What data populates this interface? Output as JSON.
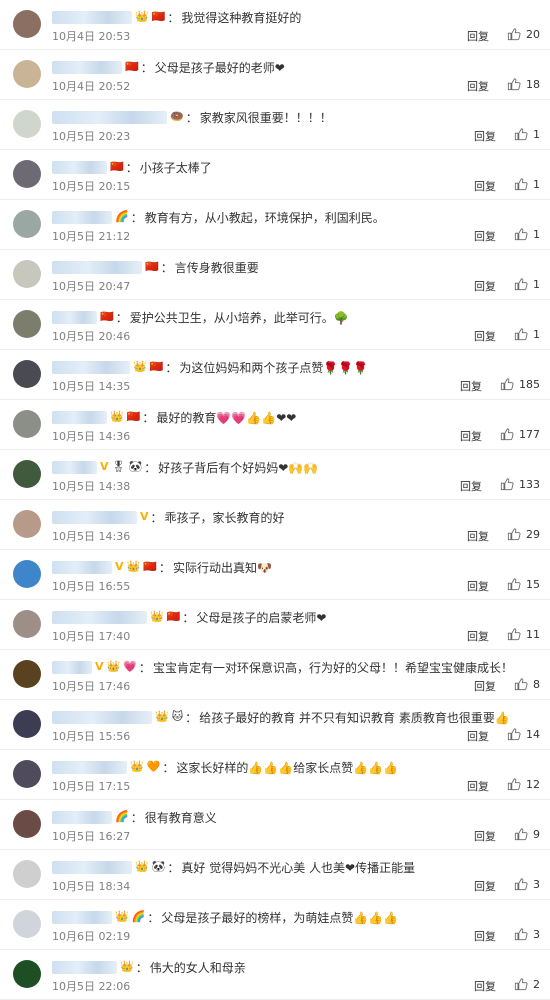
{
  "reply_label": "回复",
  "comments": [
    {
      "name_w": 80,
      "badges": [
        "👑",
        "🇨🇳"
      ],
      "text": "我觉得这种教育挺好的",
      "time": "10月4日 20:53",
      "likes": "20",
      "avatar": "#8b6f63"
    },
    {
      "name_w": 70,
      "badges": [
        "🇨🇳"
      ],
      "text": "父母是孩子最好的老师❤",
      "time": "10月4日 20:52",
      "likes": "18",
      "avatar": "#c9b596"
    },
    {
      "name_w": 115,
      "badges": [
        "🍩"
      ],
      "text": "家教家风很重要！！！！",
      "time": "10月5日 20:23",
      "likes": "1",
      "avatar": "#cfd6cc"
    },
    {
      "name_w": 55,
      "badges": [
        "🇨🇳"
      ],
      "text": "小孩子太棒了",
      "time": "10月5日 20:15",
      "likes": "1",
      "avatar": "#6e6a73"
    },
    {
      "name_w": 60,
      "badges": [
        "🌈"
      ],
      "text": "教育有方，从小教起，环境保护，利国利民。",
      "time": "10月5日 21:12",
      "likes": "1",
      "avatar": "#9aa7a3"
    },
    {
      "name_w": 90,
      "badges": [
        "🇨🇳"
      ],
      "text": "言传身教很重要",
      "time": "10月5日 20:47",
      "likes": "1",
      "avatar": "#c8c7be"
    },
    {
      "name_w": 45,
      "badges": [
        "🇨🇳"
      ],
      "text": "爱护公共卫生，从小培养，此举可行。🌳",
      "time": "10月5日 20:46",
      "likes": "1",
      "avatar": "#7d7d6e"
    },
    {
      "name_w": 78,
      "badges": [
        "👑",
        "🇨🇳"
      ],
      "text": "为这位妈妈和两个孩子点赞🌹🌹🌹",
      "time": "10月5日 14:35",
      "likes": "185",
      "avatar": "#4a4a52"
    },
    {
      "name_w": 55,
      "badges": [
        "👑",
        "🇨🇳"
      ],
      "text": "最好的教育💗💗👍👍❤❤",
      "time": "10月5日 14:36",
      "likes": "177",
      "avatar": "#8c8f87"
    },
    {
      "name_w": 45,
      "badges": [
        "V",
        "🎖",
        "🐼"
      ],
      "text": "好孩子背后有个好妈妈❤🙌🙌",
      "time": "10月5日 14:38",
      "likes": "133",
      "avatar": "#3f5a3c"
    },
    {
      "name_w": 85,
      "badges": [
        "V"
      ],
      "text": "乖孩子，家长教育的好",
      "time": "10月5日 14:36",
      "likes": "29",
      "avatar": "#b89a8a"
    },
    {
      "name_w": 60,
      "badges": [
        "V",
        "👑",
        "🇨🇳"
      ],
      "text": "实际行动出真知🐶",
      "time": "10月5日 16:55",
      "likes": "15",
      "avatar": "#3e86c9"
    },
    {
      "name_w": 95,
      "badges": [
        "👑",
        "🇨🇳"
      ],
      "text": "父母是孩子的启蒙老师❤",
      "time": "10月5日 17:40",
      "likes": "11",
      "avatar": "#9d8f88"
    },
    {
      "name_w": 40,
      "badges": [
        "V",
        "👑",
        "💗"
      ],
      "text": "宝宝肯定有一对环保意识高，行为好的父母！！希望宝宝健康成长！",
      "time": "10月5日 17:46",
      "likes": "8",
      "avatar": "#5a4220"
    },
    {
      "name_w": 100,
      "badges": [
        "👑",
        "🐱"
      ],
      "text": "给孩子最好的教育 并不只有知识教育 素质教育也很重要👍",
      "time": "10月5日 15:56",
      "likes": "14",
      "avatar": "#3c3d52"
    },
    {
      "name_w": 75,
      "badges": [
        "👑",
        "🧡"
      ],
      "text": "这家长好样的👍👍👍给家长点赞👍👍👍",
      "time": "10月5日 17:15",
      "likes": "12",
      "avatar": "#4f4b5c"
    },
    {
      "name_w": 60,
      "badges": [
        "🌈"
      ],
      "text": "很有教育意义",
      "time": "10月5日 16:27",
      "likes": "9",
      "avatar": "#6b4b45"
    },
    {
      "name_w": 80,
      "badges": [
        "👑",
        "🐼"
      ],
      "text": "真好 觉得妈妈不光心美 人也美❤传播正能量",
      "time": "10月5日 18:34",
      "likes": "3",
      "avatar": "#cfcfcf"
    },
    {
      "name_w": 60,
      "badges": [
        "👑",
        "🌈"
      ],
      "text": "父母是孩子最好的榜样，为萌娃点赞👍👍👍",
      "time": "10月6日 02:19",
      "likes": "3",
      "avatar": "#d0d4dc"
    },
    {
      "name_w": 65,
      "badges": [
        "👑"
      ],
      "text": "伟大的女人和母亲",
      "time": "10月5日 22:06",
      "likes": "2",
      "avatar": "#1e4f24"
    }
  ]
}
